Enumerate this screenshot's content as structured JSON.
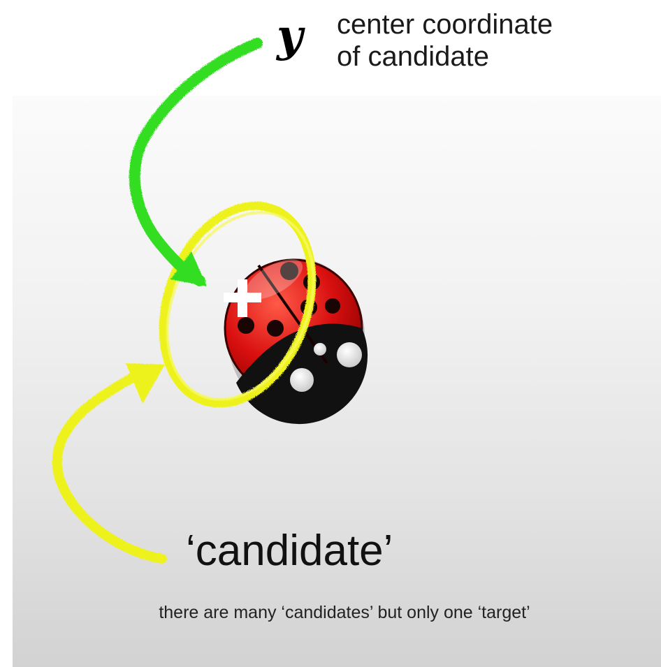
{
  "annotation": {
    "symbol": "y",
    "line1": "center coordinate",
    "line2": "of candidate"
  },
  "labels": {
    "candidate": "‘candidate’",
    "note": "there are many ‘candidates’ but only one ‘target’"
  },
  "icons": {
    "center_marker": "plus-icon",
    "object": "ladybug-icon"
  },
  "colors": {
    "green_arrow": "#33dd22",
    "yellow_marks": "#eef21a",
    "ladybug_red": "#cc0a0a",
    "ladybug_black": "#111111"
  }
}
